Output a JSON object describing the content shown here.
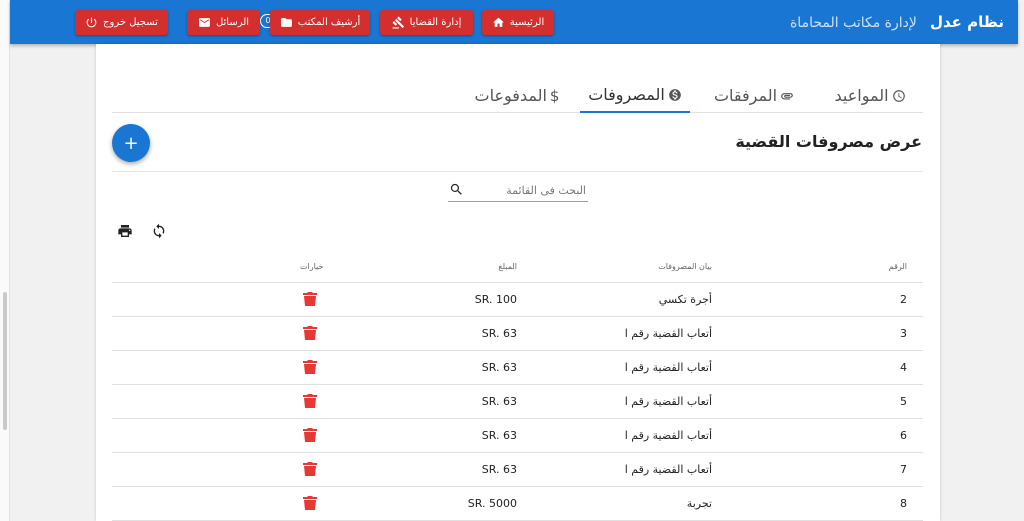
{
  "app": {
    "brand_name": "نظام عدل",
    "brand_subtitle": "لإدارة مكاتب المحاماة"
  },
  "nav": {
    "logout_label": "تسجيل خروج",
    "messages_label": "الرسائل",
    "messages_badge": "0",
    "archive_label": "أرشيف المكتب",
    "cases_label": "إدارة القضايا",
    "home_label": "الرئيسية"
  },
  "tabs": {
    "appointments": "المواعيد",
    "attachments": "المرفقات",
    "expenses": "المصروفات",
    "payments": "المدفوعات"
  },
  "page": {
    "title": "عرض مصروفات القضية",
    "add_label": "+"
  },
  "search": {
    "placeholder": "البحث فى القائمة",
    "value": ""
  },
  "table": {
    "headers": {
      "number": "الرقم",
      "description": "بيان المصروفات",
      "amount": "المبلغ",
      "options": "خيارات"
    },
    "rows": [
      {
        "number": "2",
        "description": "أجرة تكسي",
        "amount": "SR. 100"
      },
      {
        "number": "3",
        "description": "أتعاب القضية رقم ا",
        "amount": "SR. 63"
      },
      {
        "number": "4",
        "description": "أتعاب القضية رقم ا",
        "amount": "SR. 63"
      },
      {
        "number": "5",
        "description": "أتعاب القضية رقم ا",
        "amount": "SR. 63"
      },
      {
        "number": "6",
        "description": "أتعاب القضية رقم ا",
        "amount": "SR. 63"
      },
      {
        "number": "7",
        "description": "أتعاب القضية رقم ا",
        "amount": "SR. 63"
      },
      {
        "number": "8",
        "description": "تجربة",
        "amount": "SR. 5000"
      }
    ]
  },
  "colors": {
    "primary": "#1976d2",
    "danger": "#d32f2f",
    "delete_icon": "#e53935"
  },
  "icons": {
    "logout": "power-icon",
    "messages": "mail-icon",
    "archive": "folder-icon",
    "cases": "gavel-icon",
    "home": "home-icon",
    "search": "search-icon",
    "print": "print-icon",
    "refresh": "refresh-icon",
    "delete": "trash-icon"
  }
}
